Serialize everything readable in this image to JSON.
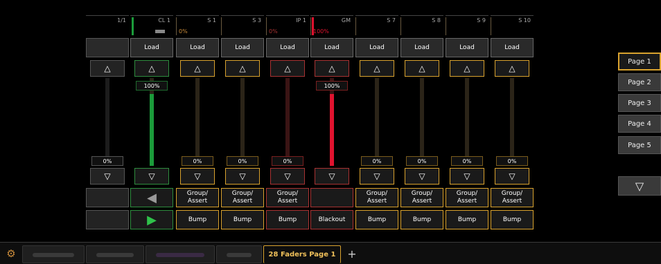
{
  "header": {
    "cells": [
      {
        "id": "h0",
        "number": "1/1",
        "percent": ""
      },
      {
        "id": "h1",
        "number": "CL 1",
        "percent": ""
      },
      {
        "id": "h2",
        "number": "S 1",
        "percent": "0%"
      },
      {
        "id": "h3",
        "number": "S 3",
        "percent": ""
      },
      {
        "id": "h4",
        "number": "IP 1",
        "percent": "0%"
      },
      {
        "id": "h5",
        "number": "GM",
        "percent": "100%"
      },
      {
        "id": "h6",
        "number": "S 7",
        "percent": ""
      },
      {
        "id": "h7",
        "number": "S 8",
        "percent": ""
      },
      {
        "id": "h8",
        "number": "S 9",
        "percent": ""
      },
      {
        "id": "h9",
        "number": "S 10",
        "percent": ""
      }
    ]
  },
  "faders": [
    {
      "load": "",
      "up": "△",
      "top_value": "",
      "level": 0,
      "value": "0%",
      "down": "▽",
      "row3": "",
      "row4": "",
      "color": "grey"
    },
    {
      "load": "Load",
      "up": "△",
      "top_value": "100%",
      "level": 1.0,
      "value": "",
      "down": "▽",
      "row3": "◀",
      "row4": "▶",
      "color": "green"
    },
    {
      "load": "Load",
      "up": "△",
      "top_value": "",
      "level": 0,
      "value": "0%",
      "down": "▽",
      "row3": "Group/ Assert",
      "row4": "Bump",
      "color": "amber"
    },
    {
      "load": "Load",
      "up": "△",
      "top_value": "",
      "level": 0,
      "value": "0%",
      "down": "▽",
      "row3": "Group/ Assert",
      "row4": "Bump",
      "color": "amber"
    },
    {
      "load": "Load",
      "up": "△",
      "top_value": "",
      "level": 0,
      "value": "0%",
      "down": "▽",
      "row3": "Group/ Assert",
      "row4": "Bump",
      "color": "red"
    },
    {
      "load": "Load",
      "up": "△",
      "top_value": "100%",
      "level": 1.0,
      "value": "",
      "down": "▽",
      "row3": "",
      "row4": "Blackout",
      "color": "red"
    },
    {
      "load": "Load",
      "up": "△",
      "top_value": "",
      "level": 0,
      "value": "0%",
      "down": "▽",
      "row3": "Group/ Assert",
      "row4": "Bump",
      "color": "amber"
    },
    {
      "load": "Load",
      "up": "△",
      "top_value": "",
      "level": 0,
      "value": "0%",
      "down": "▽",
      "row3": "Group/ Assert",
      "row4": "Bump",
      "color": "amber"
    },
    {
      "load": "Load",
      "up": "△",
      "top_value": "",
      "level": 0,
      "value": "0%",
      "down": "▽",
      "row3": "Group/ Assert",
      "row4": "Bump",
      "color": "amber"
    },
    {
      "load": "Load",
      "up": "△",
      "top_value": "",
      "level": 0,
      "value": "0%",
      "down": "▽",
      "row3": "Group/ Assert",
      "row4": "Bump",
      "color": "amber"
    }
  ],
  "pages": {
    "items": [
      "Page 1",
      "Page 2",
      "Page 3",
      "Page 4",
      "Page 5"
    ],
    "active": 0,
    "down_icon": "▽"
  },
  "tabs": {
    "gear_icon": "⚙",
    "active_label": "28 Faders Page 1",
    "add_icon": "+"
  },
  "colors": {
    "amber": "#d9a22e",
    "red": "#a83232",
    "green": "#2e8c3e",
    "fill_green": "#1b9b3a",
    "fill_red": "#e0132f"
  }
}
